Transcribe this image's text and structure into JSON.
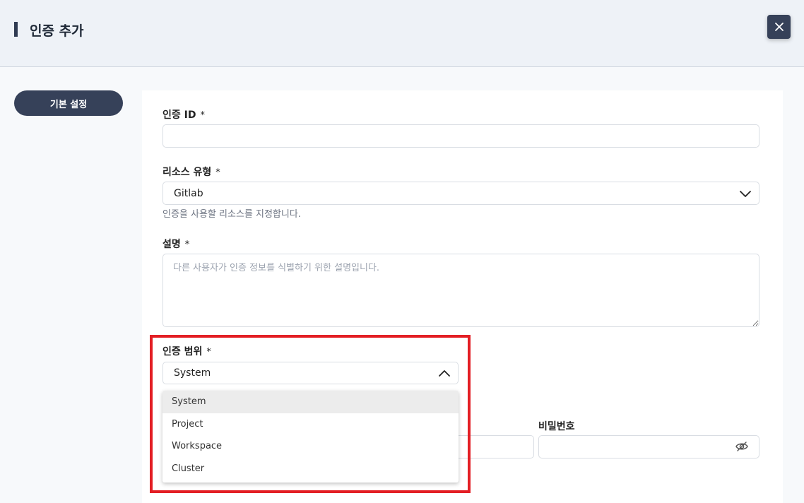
{
  "header": {
    "title": "인증 추가"
  },
  "sidebar": {
    "items": [
      {
        "label": "기본 설정"
      }
    ]
  },
  "form": {
    "auth_id": {
      "label": "인증 ID",
      "required_mark": "*",
      "value": ""
    },
    "resource_type": {
      "label": "리소스 유형",
      "required_mark": "*",
      "value": "Gitlab",
      "helper": "인증을 사용할 리소스를 지정합니다."
    },
    "description": {
      "label": "설명",
      "required_mark": "*",
      "placeholder": "다른 사용자가 인증 정보를 식별하기 위한 설명입니다."
    },
    "auth_scope": {
      "label": "인증 범위",
      "required_mark": "*",
      "value": "System",
      "options": [
        "System",
        "Project",
        "Workspace",
        "Cluster"
      ]
    },
    "password": {
      "label": "비밀번호",
      "value": ""
    }
  },
  "colors": {
    "primary": "#364159",
    "highlight": "#e31e24"
  },
  "icons": {
    "close": "close-icon",
    "chevron_down": "chevron-down-icon",
    "chevron_up": "chevron-up-icon",
    "eye_off": "eye-off-icon"
  }
}
